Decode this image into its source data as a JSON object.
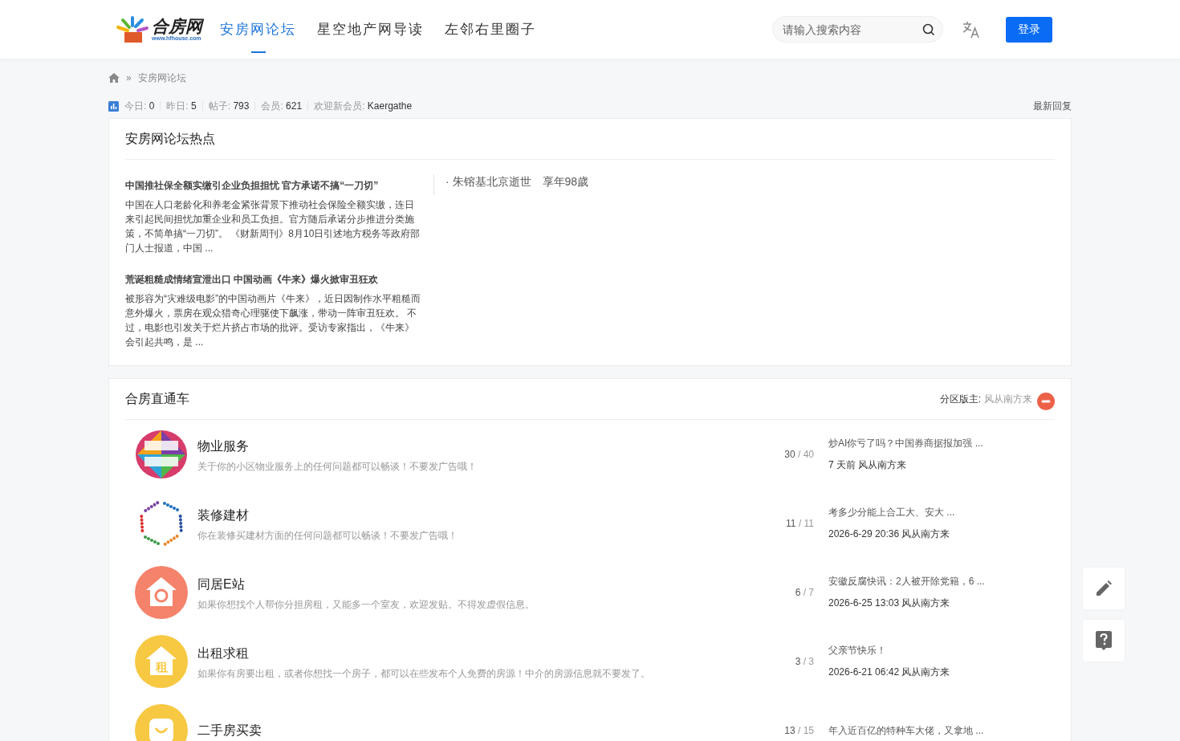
{
  "header": {
    "logo_text": "合房网",
    "logo_url": "www.hfhouse.com",
    "nav": [
      {
        "label": "安房网论坛",
        "selected": true
      },
      {
        "label": "星空地产网导读",
        "selected": false
      },
      {
        "label": "左邻右里圈子",
        "selected": false
      }
    ],
    "search": {
      "placeholder": "请输入搜索内容"
    },
    "login": "登录"
  },
  "breadcrumb_separator": "»",
  "breadcrumb": [
    "安房网论坛"
  ],
  "stats": [
    {
      "label": "今日:",
      "value": "0"
    },
    {
      "label": "昨日:",
      "value": "5"
    },
    {
      "label": "帖子:",
      "value": "793"
    },
    {
      "label": "会员:",
      "value": "621"
    },
    {
      "label": "欢迎新会员:",
      "value": "Kaergathe"
    }
  ],
  "latest_link": "最新回复",
  "hot": {
    "title": "安房网论坛热点",
    "articles": [
      {
        "title": "中国推社保全额实缴引企业负担担忧 官方承诺不搞“一刀切”",
        "summary": "中国在人口老龄化和养老金紧张背景下推动社会保险全额实缴，连日来引起民间担忧加重企业和员工负担。官方随后承诺分步推进分类施策，不简单搞“一刀切”。 《财新周刊》8月10日引述地方税务等政府部门人士报道，中国 ..."
      },
      {
        "title": "荒诞粗糙成情绪宣泄出口 中国动画《牛来》爆火掀审丑狂欢",
        "summary": "被形容为“灾难级电影”的中国动画片《牛来》，近日因制作水平粗糙而意外爆火，票房在观众猎奇心理驱使下飙涨，带动一阵审丑狂欢。 不过，电影也引发关于烂片挤占市场的批评。受访专家指出，《牛来》会引起共鸣，是 ..."
      }
    ],
    "links": [
      "· 朱镕基北京逝世　享年98歲"
    ]
  },
  "section": {
    "title": "合房直通车",
    "moderator_label": "分区版主:",
    "moderator": "风从南方来",
    "forums": [
      {
        "kind": "mosaic",
        "title": "物业服务",
        "description": "关于你的小区物业服务上的任何问题都可以畅谈！不要发广告哦！",
        "threads": "30",
        "posts": "/ 40",
        "last_title": "炒AI你亏了吗？中国券商据报加强 ...",
        "last_meta": "7 天前 风从南方来"
      },
      {
        "kind": "dots",
        "title": "装修建材",
        "description": "你在装修买建材方面的任何问题都可以畅谈！不要发广告哦！",
        "threads": "11",
        "posts": "/ 11",
        "last_title": "考多少分能上合工大、安大 ...",
        "last_meta": "2026-6-29 20:36 风从南方来"
      },
      {
        "kind": "house-refresh",
        "title": "同居E站",
        "description": "如果你想找个人帮你分担房租，又能多一个室友，欢迎发贴。不得发虚假信息。",
        "threads": "6",
        "posts": "/ 7",
        "last_title": "安徽反腐快讯：2人被开除党籍，6 ...",
        "last_meta": "2026-6-25 13:03 风从南方来"
      },
      {
        "kind": "house-rent",
        "icon_text": "租",
        "title": "出租求租",
        "description": "如果你有房要出租，或者你想找一个房子，都可以在些发布个人免费的房源！中介的房源信息就不要发了。",
        "threads": "3",
        "posts": "/ 3",
        "last_title": "父亲节快乐！",
        "last_meta": "2026-6-21 06:42 风从南方来"
      },
      {
        "kind": "bag-smile",
        "title": "二手房买卖",
        "threads": "13",
        "posts": "/ 15",
        "last_title": "年入近百亿的特种车大佬，又拿地 ..."
      }
    ]
  }
}
